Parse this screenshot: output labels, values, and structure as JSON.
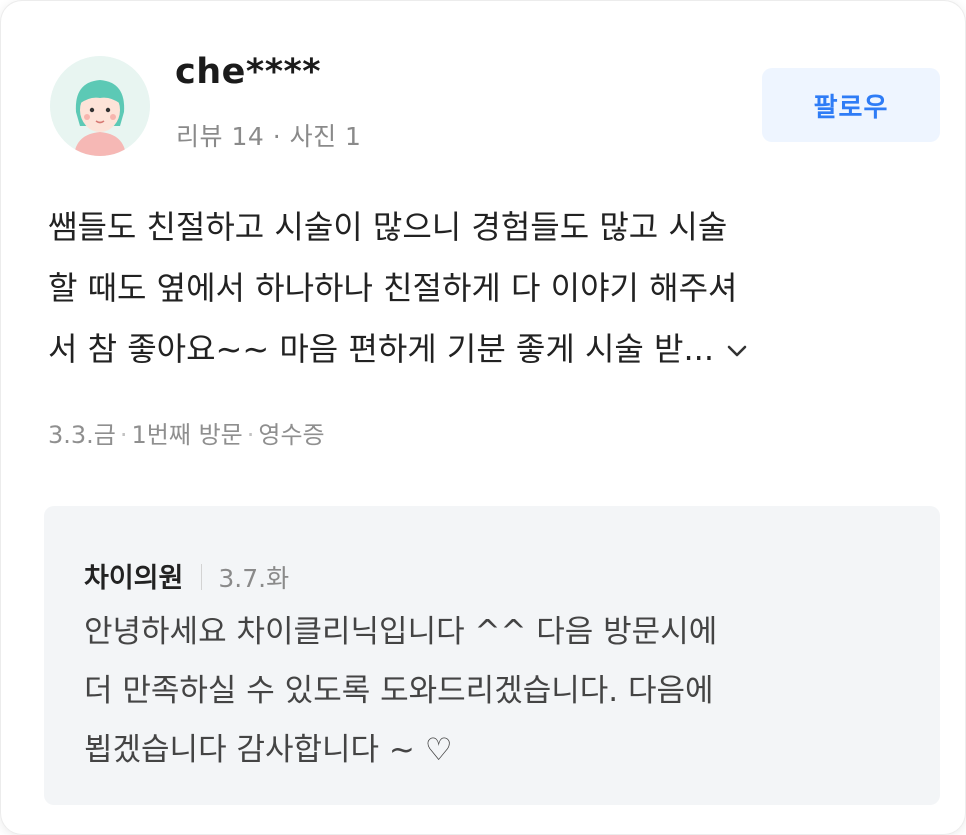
{
  "review": {
    "author": "che****",
    "author_stats": "리뷰 14 · 사진 1",
    "follow_label": "팔로우",
    "body_lines": [
      "쌤들도 친절하고 시술이 많으니 경험들도 많고 시술",
      "할 때도 옆에서 하나하나 친절하게 다 이야기 해주셔",
      "서 참 좋아요~~ 마음 편하게 기분 좋게 시술 받..."
    ],
    "expand_icon": "chevron-down-icon",
    "visit_date": "3.3.금",
    "visit_count": "1번째 방문",
    "verification": "영수증"
  },
  "reply": {
    "author": "차이의원",
    "date": "3.7.화",
    "body_lines": [
      "안녕하세요 차이클리닉입니다 ^^ 다음 방문시에",
      "더 만족하실 수 있도록 도와드리겠습니다. 다음에",
      "뵙겠습니다 감사합니다 ~ ♡"
    ]
  },
  "colors": {
    "accent": "#2e7cf6",
    "follow_bg": "#eef5ff",
    "reply_bg": "#f3f5f7",
    "muted_text": "#8a8a8a"
  }
}
